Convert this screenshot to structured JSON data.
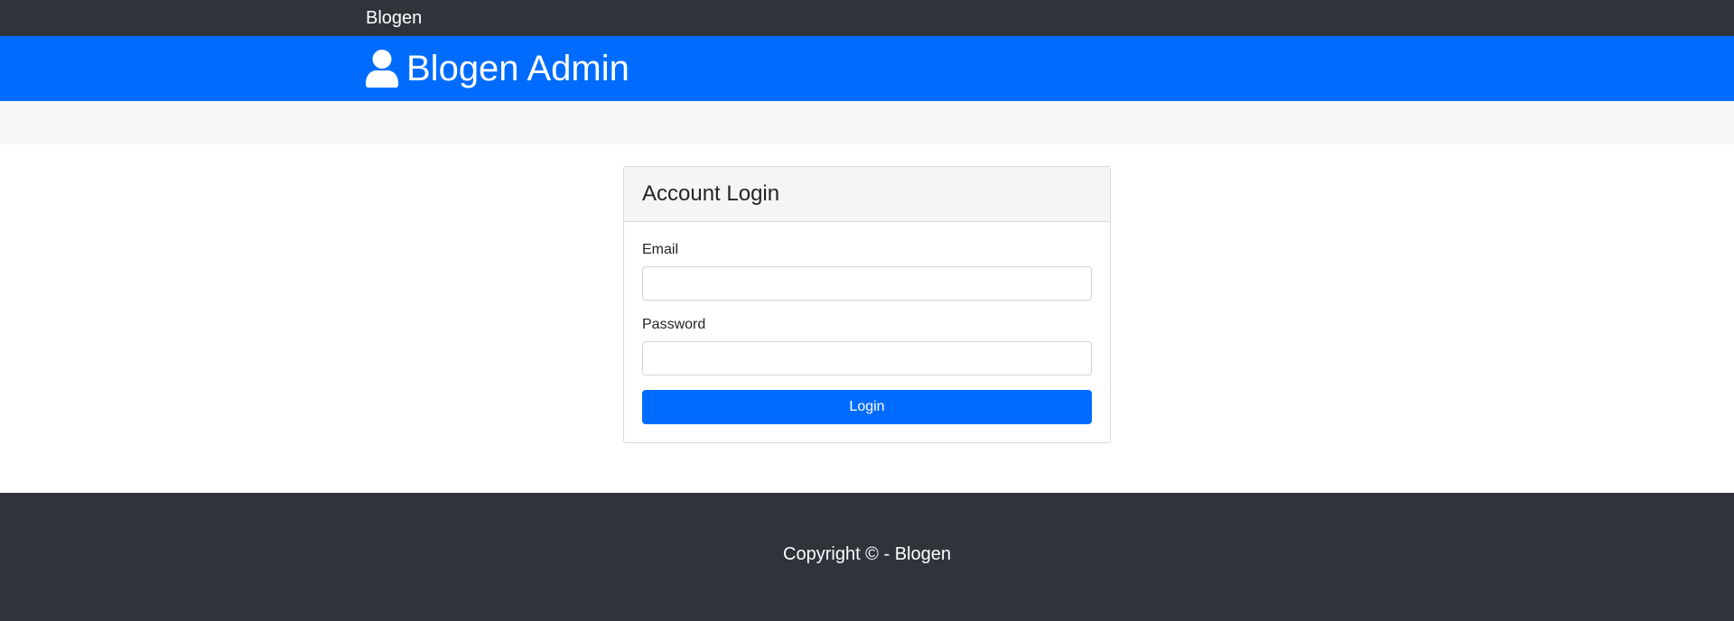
{
  "navbar": {
    "brand": "Blogen"
  },
  "header": {
    "icon": "user-icon",
    "title": "Blogen Admin"
  },
  "login_card": {
    "title": "Account Login",
    "email_label": "Email",
    "email_value": "",
    "password_label": "Password",
    "password_value": "",
    "submit_label": "Login"
  },
  "footer": {
    "text": "Copyright © - Blogen"
  },
  "colors": {
    "navbar_bg": "#2f333a",
    "header_bg": "#006cff",
    "accent": "#006cff",
    "strip_bg": "#f7f8f9",
    "footer_bg": "#2f333a"
  }
}
